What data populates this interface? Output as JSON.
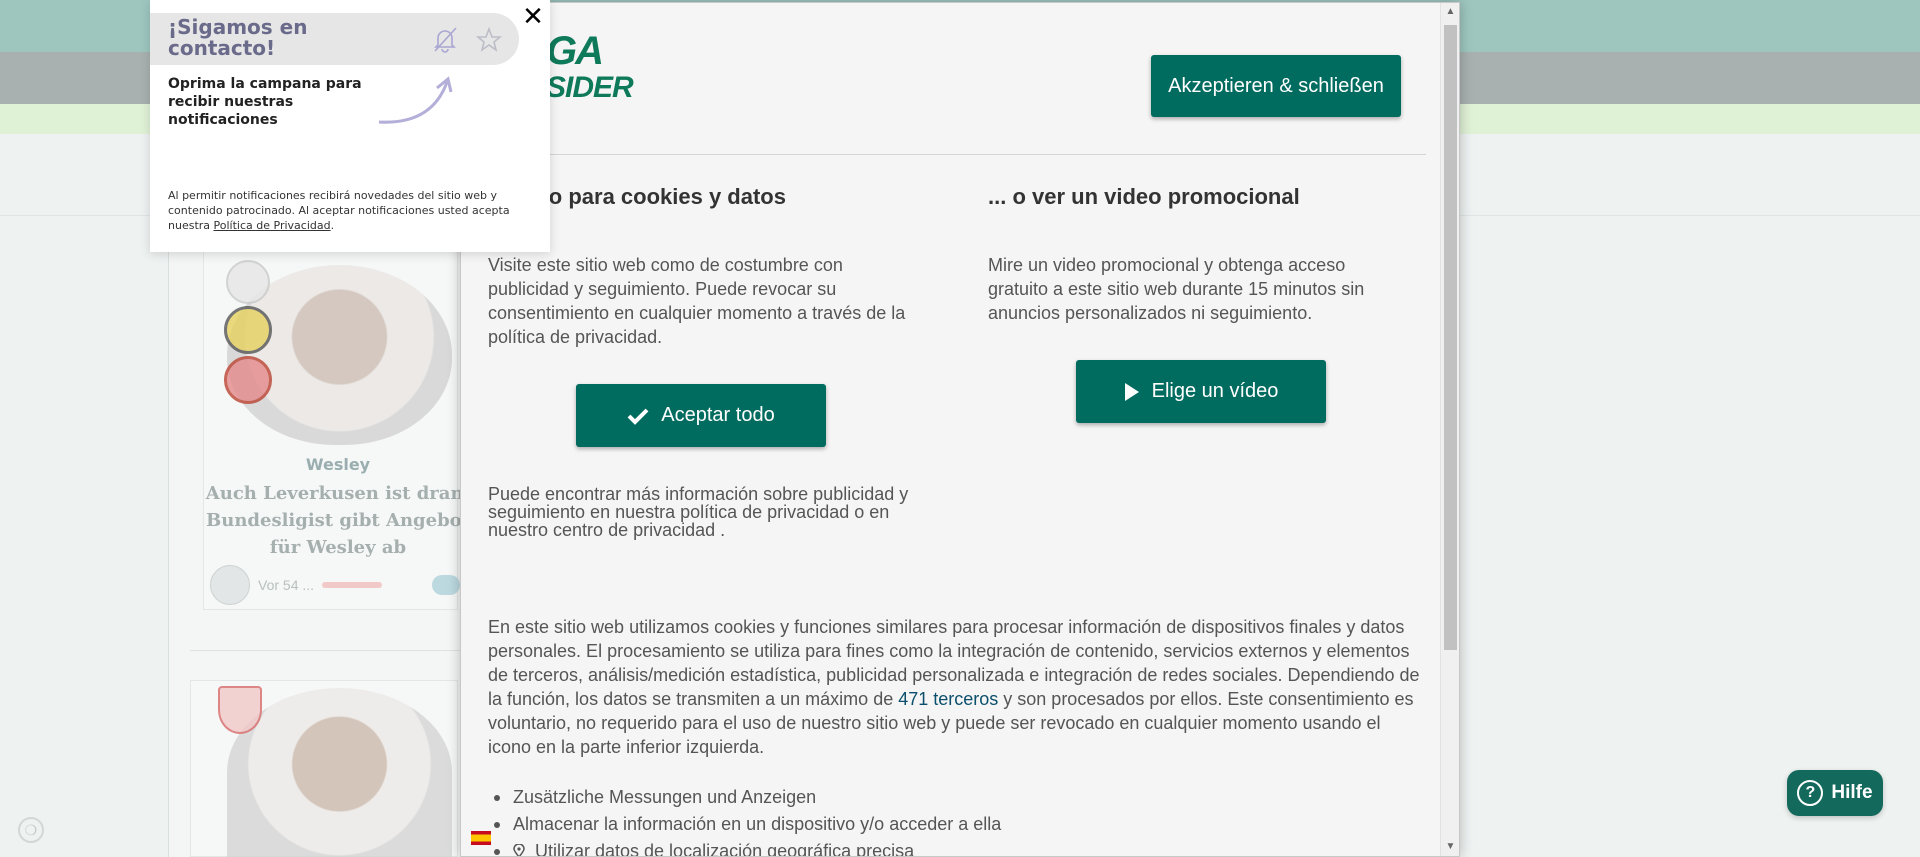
{
  "notification": {
    "title": "¡Sigamos en contacto!",
    "subtitle": "Oprima la campana para recibir nuestras notificaciones",
    "legal_prefix": "Al permitir notificaciones recibirá novedades del sitio web y contenido patrocinado. Al aceptar notificaciones usted acepta nuestra ",
    "privacy_link": "Política de Privacidad",
    "legal_suffix": ".",
    "close": "✕",
    "icons": [
      "bell-off-icon",
      "star-icon",
      "curved-arrow-icon",
      "close-icon"
    ]
  },
  "consent": {
    "logo_line1": "GA",
    "logo_line2": "SIDER",
    "accept_close_label": "Akzeptieren & schließen",
    "col1": {
      "title": "entimiento para cookies y datos",
      "text": "Visite este sitio web como de costumbre con publicidad y seguimiento. Puede revocar su consentimiento en cualquier momento a través de la política de privacidad.",
      "button": "Aceptar todo",
      "more_info": "Puede encontrar más información sobre publicidad y seguimiento en nuestra política de privacidad o en nuestro centro de privacidad ."
    },
    "col2": {
      "title": "... o ver un video promocional",
      "text": "Mire un video promocional y obtenga acceso gratuito a este sitio web durante 15 minutos sin anuncios personalizados ni seguimiento.",
      "button": "Elige un vídeo"
    },
    "main_text_1": "En este sitio web utilizamos cookies y funciones similares para procesar información de dispositivos finales y datos personales. El procesamiento se utiliza para fines como la integración de contenido, servicios externos y elementos de terceros, análisis/medición estadística, publicidad personalizada e integración de redes sociales. Dependiendo de la función, los datos se transmiten a un máximo de ",
    "third_parties_link": "471 terceros",
    "main_text_2": " y son procesados por ellos. Este consentimiento es voluntario, no requerido para el uso de nuestro sitio web y puede ser revocado en cualquier momento usando el icono en la parte inferior izquierda.",
    "purposes": [
      "Zusätzliche Messungen und Anzeigen",
      "Almacenar la información en un dispositivo y/o acceder a ella",
      "Utilizar datos de localización geográfica precisa"
    ],
    "language_flag": "spain-flag-icon"
  },
  "background": {
    "card_name": "Wesley",
    "card_headline": "Auch Leverkusen ist dran: Bundesligist gibt Angebot für Wesley ab",
    "card_time": "Vor 54 ..."
  },
  "help_label": "Hilfe",
  "colors": {
    "primary": "#006b5f",
    "help": "#13695c",
    "notif_title": "#6a6a8a"
  }
}
